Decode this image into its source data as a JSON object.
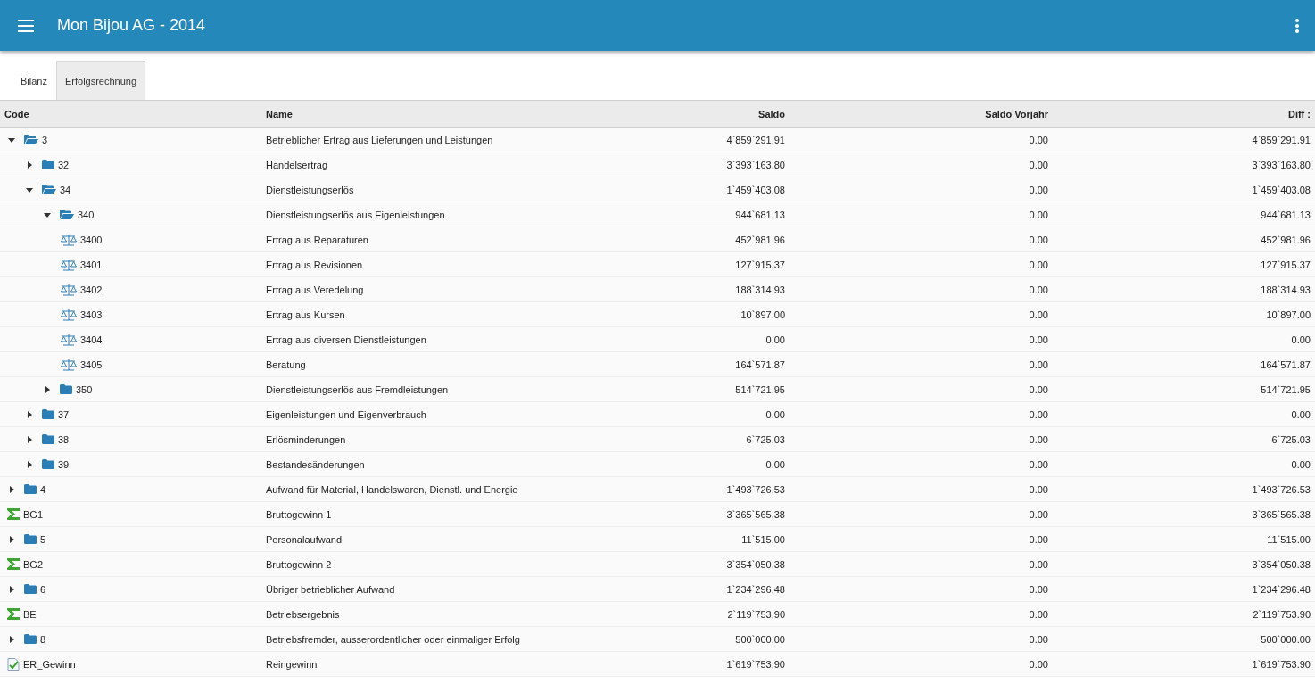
{
  "app_bar": {
    "title": "Mon Bijou AG - 2014"
  },
  "tabs": [
    {
      "label": "Bilanz",
      "selected": false
    },
    {
      "label": "Erfolgsrechnung",
      "selected": true
    }
  ],
  "table": {
    "columns": [
      "Code",
      "Name",
      "Saldo",
      "Saldo Vorjahr",
      "Diff :"
    ],
    "rows": [
      {
        "kind": "group",
        "expanded": true,
        "code": "3",
        "name": "Betrieblicher Ertrag aus Lieferungen und Leistungen",
        "saldo": "4`859`291.91",
        "saldo_vorjahr": "0.00",
        "diff": "4`859`291.91",
        "children": [
          {
            "kind": "group",
            "expanded": false,
            "code": "32",
            "name": "Handelsertrag",
            "saldo": "3`393`163.80",
            "saldo_vorjahr": "0.00",
            "diff": "3`393`163.80"
          },
          {
            "kind": "group",
            "expanded": true,
            "code": "34",
            "name": "Dienstleistungserlös",
            "saldo": "1`459`403.08",
            "saldo_vorjahr": "0.00",
            "diff": "1`459`403.08",
            "children": [
              {
                "kind": "group",
                "expanded": true,
                "code": "340",
                "name": "Dienstleistungserlös aus Eigenleistungen",
                "saldo": "944`681.13",
                "saldo_vorjahr": "0.00",
                "diff": "944`681.13",
                "children": [
                  {
                    "kind": "account",
                    "code": "3400",
                    "name": "Ertrag aus Reparaturen",
                    "saldo": "452`981.96",
                    "saldo_vorjahr": "0.00",
                    "diff": "452`981.96"
                  },
                  {
                    "kind": "account",
                    "code": "3401",
                    "name": "Ertrag aus Revisionen",
                    "saldo": "127`915.37",
                    "saldo_vorjahr": "0.00",
                    "diff": "127`915.37"
                  },
                  {
                    "kind": "account",
                    "code": "3402",
                    "name": "Ertrag aus Veredelung",
                    "saldo": "188`314.93",
                    "saldo_vorjahr": "0.00",
                    "diff": "188`314.93"
                  },
                  {
                    "kind": "account",
                    "code": "3403",
                    "name": "Ertrag aus Kursen",
                    "saldo": "10`897.00",
                    "saldo_vorjahr": "0.00",
                    "diff": "10`897.00"
                  },
                  {
                    "kind": "account",
                    "code": "3404",
                    "name": "Ertrag aus diversen Dienstleistungen",
                    "saldo": "0.00",
                    "saldo_vorjahr": "0.00",
                    "diff": "0.00"
                  },
                  {
                    "kind": "account",
                    "code": "3405",
                    "name": "Beratung",
                    "saldo": "164`571.87",
                    "saldo_vorjahr": "0.00",
                    "diff": "164`571.87"
                  }
                ]
              },
              {
                "kind": "group",
                "expanded": false,
                "code": "350",
                "name": "Dienstleistungserlös aus Fremdleistungen",
                "saldo": "514`721.95",
                "saldo_vorjahr": "0.00",
                "diff": "514`721.95"
              }
            ]
          },
          {
            "kind": "group",
            "expanded": false,
            "code": "37",
            "name": "Eigenleistungen und Eigenverbrauch",
            "saldo": "0.00",
            "saldo_vorjahr": "0.00",
            "diff": "0.00"
          },
          {
            "kind": "group",
            "expanded": false,
            "code": "38",
            "name": "Erlösminderungen",
            "saldo": "6`725.03",
            "saldo_vorjahr": "0.00",
            "diff": "6`725.03"
          },
          {
            "kind": "group",
            "expanded": false,
            "code": "39",
            "name": "Bestandesänderungen",
            "saldo": "0.00",
            "saldo_vorjahr": "0.00",
            "diff": "0.00"
          }
        ]
      },
      {
        "kind": "group",
        "expanded": false,
        "code": "4",
        "name": "Aufwand für Material, Handelswaren, Dienstl. und Energie",
        "saldo": "1`493`726.53",
        "saldo_vorjahr": "0.00",
        "diff": "1`493`726.53"
      },
      {
        "kind": "sum",
        "code": "BG1",
        "name": "Bruttogewinn 1",
        "saldo": "3`365`565.38",
        "saldo_vorjahr": "0.00",
        "diff": "3`365`565.38"
      },
      {
        "kind": "group",
        "expanded": false,
        "code": "5",
        "name": "Personalaufwand",
        "saldo": "11`515.00",
        "saldo_vorjahr": "0.00",
        "diff": "11`515.00"
      },
      {
        "kind": "sum",
        "code": "BG2",
        "name": "Bruttogewinn 2",
        "saldo": "3`354`050.38",
        "saldo_vorjahr": "0.00",
        "diff": "3`354`050.38"
      },
      {
        "kind": "group",
        "expanded": false,
        "code": "6",
        "name": "Übriger betrieblicher Aufwand",
        "saldo": "1`234`296.48",
        "saldo_vorjahr": "0.00",
        "diff": "1`234`296.48"
      },
      {
        "kind": "sum",
        "code": "BE",
        "name": "Betriebsergebnis",
        "saldo": "2`119`753.90",
        "saldo_vorjahr": "0.00",
        "diff": "2`119`753.90"
      },
      {
        "kind": "group",
        "expanded": false,
        "code": "8",
        "name": "Betriebsfremder, ausserordentlicher oder einmaliger Erfolg",
        "saldo": "500`000.00",
        "saldo_vorjahr": "0.00",
        "diff": "500`000.00"
      },
      {
        "kind": "result",
        "code": "ER_Gewinn",
        "name": "Reingewinn",
        "saldo": "1`619`753.90",
        "saldo_vorjahr": "0.00",
        "diff": "1`619`753.90"
      }
    ]
  }
}
